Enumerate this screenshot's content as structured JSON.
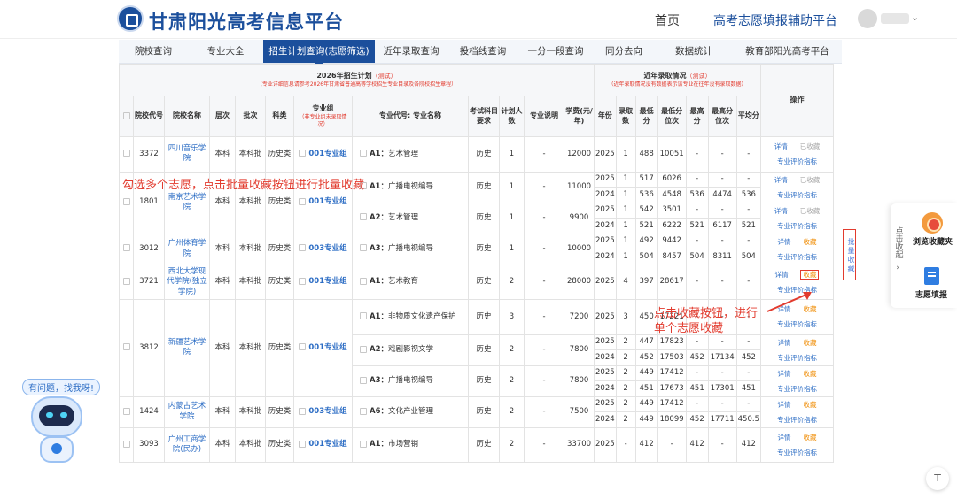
{
  "header": {
    "site_title": "甘肃阳光高考信息平台",
    "home": "首页",
    "assist": "高考志愿填报辅助平台"
  },
  "nav": [
    "院校查询",
    "专业大全",
    "招生计划查询(志愿筛选)",
    "近年录取查询",
    "投档线查询",
    "一分一段查询",
    "同分去向",
    "数据统计",
    "教育部阳光高考平台"
  ],
  "table": {
    "plan_title": "2026年招生计划",
    "plan_tag": "（测试）",
    "plan_note": "（专业详细信息请参考2026年甘肃省普通高等学校招生专业目录及各院校招生章程）",
    "hist_title": "近年录取情况",
    "hist_tag": "（测试）",
    "hist_note": "（近年录取情况没有数据表示该专业在往年没有录取数据）",
    "ops_header": "操作",
    "headers": {
      "code": "院校代号",
      "school": "院校名称",
      "level": "层次",
      "batch": "批次",
      "subject": "科类",
      "group": "专业组",
      "group_note": "（非专业组未录取情况）",
      "major": "专业代号: 专业名称",
      "req": "考试科目要求",
      "plan": "计划人数",
      "desc": "专业说明",
      "fee": "学费(元/年)",
      "year": "年份",
      "admit": "录取数",
      "min": "最低分",
      "minrank": "最低分位次",
      "max": "最高分",
      "maxrank": "最高分位次",
      "avg": "平均分"
    },
    "op_labels": {
      "detail": "详情",
      "collected": "已收藏",
      "collect": "收藏",
      "eval": "专业评价指标"
    },
    "schools": [
      {
        "code": "3372",
        "name": "四川音乐学院",
        "level": "本科",
        "batch": "本科批",
        "subject": "历史类",
        "majors": [
          {
            "group": "001专业组",
            "code": "A1",
            "name": "艺术管理",
            "req": "历史",
            "plan": "1",
            "desc": "-",
            "fee": "12000",
            "hist": [
              [
                "2025",
                "1",
                "488",
                "10051",
                "-",
                "-",
                "-"
              ]
            ],
            "status": "已收藏"
          }
        ]
      },
      {
        "code": "1801",
        "name": "南京艺术学院",
        "level": "本科",
        "batch": "本科批",
        "subject": "历史类",
        "group": "001专业组",
        "majors": [
          {
            "code": "A1",
            "name": "广播电视编导",
            "req": "历史",
            "plan": "1",
            "desc": "-",
            "fee": "11000",
            "hist": [
              [
                "2025",
                "1",
                "517",
                "6026",
                "-",
                "-",
                "-"
              ],
              [
                "2024",
                "1",
                "536",
                "4548",
                "536",
                "4474",
                "536"
              ]
            ],
            "status": "已收藏"
          },
          {
            "code": "A2",
            "name": "艺术管理",
            "req": "历史",
            "plan": "1",
            "desc": "-",
            "fee": "9900",
            "hist": [
              [
                "2025",
                "1",
                "542",
                "3501",
                "-",
                "-",
                "-"
              ],
              [
                "2024",
                "1",
                "521",
                "6222",
                "521",
                "6117",
                "521"
              ]
            ],
            "status": "已收藏"
          }
        ]
      },
      {
        "code": "3012",
        "name": "广州体育学院",
        "level": "本科",
        "batch": "本科批",
        "subject": "历史类",
        "majors": [
          {
            "group": "003专业组",
            "code": "A3",
            "name": "广播电视编导",
            "req": "历史",
            "plan": "1",
            "desc": "-",
            "fee": "10000",
            "hist": [
              [
                "2025",
                "1",
                "492",
                "9442",
                "-",
                "-",
                "-"
              ],
              [
                "2024",
                "1",
                "504",
                "8457",
                "504",
                "8311",
                "504"
              ]
            ],
            "status": "收藏"
          }
        ]
      },
      {
        "code": "3721",
        "name": "西北大学现代学院(独立学院)",
        "level": "本科",
        "batch": "本科批",
        "subject": "历史类",
        "majors": [
          {
            "group": "001专业组",
            "code": "A1",
            "name": "艺术教育",
            "req": "历史",
            "plan": "2",
            "desc": "-",
            "fee": "28000",
            "hist": [
              [
                "2025",
                "4",
                "397",
                "28617",
                "-",
                "-",
                "-"
              ]
            ],
            "status": "收藏"
          }
        ]
      },
      {
        "code": "3812",
        "name": "新疆艺术学院",
        "level": "本科",
        "batch": "本科批",
        "subject": "历史类",
        "group": "001专业组",
        "majors": [
          {
            "code": "A1",
            "name": "非物质文化遗产保护",
            "req": "历史",
            "plan": "3",
            "desc": "-",
            "fee": "7200",
            "hist": [
              [
                "2025",
                "3",
                "450",
                "17221",
                "-",
                "-",
                "-"
              ]
            ],
            "status": "收藏"
          },
          {
            "code": "A2",
            "name": "戏剧影视文学",
            "req": "历史",
            "plan": "2",
            "desc": "-",
            "fee": "7800",
            "hist": [
              [
                "2025",
                "2",
                "447",
                "17823",
                "-",
                "-",
                "-"
              ],
              [
                "2024",
                "2",
                "452",
                "17503",
                "452",
                "17134",
                "452"
              ]
            ],
            "status": "收藏"
          },
          {
            "code": "A3",
            "name": "广播电视编导",
            "req": "历史",
            "plan": "2",
            "desc": "-",
            "fee": "7800",
            "hist": [
              [
                "2025",
                "2",
                "449",
                "17412",
                "-",
                "-",
                "-"
              ],
              [
                "2024",
                "2",
                "451",
                "17673",
                "451",
                "17301",
                "451"
              ]
            ],
            "status": "收藏"
          }
        ]
      },
      {
        "code": "1424",
        "name": "内蒙古艺术学院",
        "level": "本科",
        "batch": "本科批",
        "subject": "历史类",
        "majors": [
          {
            "group": "003专业组",
            "code": "A6",
            "name": "文化产业管理",
            "req": "历史",
            "plan": "2",
            "desc": "-",
            "fee": "7500",
            "hist": [
              [
                "2025",
                "2",
                "449",
                "17412",
                "-",
                "-",
                "-"
              ],
              [
                "2024",
                "2",
                "449",
                "18099",
                "452",
                "17711",
                "450.5"
              ]
            ],
            "status": "收藏"
          }
        ]
      },
      {
        "code": "3093",
        "name": "广州工商学院(民办)",
        "level": "本科",
        "batch": "本科批",
        "subject": "历史类",
        "majors": [
          {
            "group": "001专业组",
            "code": "A1",
            "name": "市场营销",
            "req": "历史",
            "plan": "2",
            "desc": "-",
            "fee": "33700",
            "hist": [
              [
                "2025",
                "-",
                "412",
                "-",
                "412",
                "-",
                "412"
              ]
            ],
            "status": "收藏"
          }
        ]
      }
    ]
  },
  "annotations": {
    "batch_text": "勾选多个志愿，点击批量收藏按钮进行批量收藏",
    "single_text_1": "点击收藏按钮，进行",
    "single_text_2": "单个志愿收藏",
    "batch_button": "批量收藏"
  },
  "side": {
    "toggle": "点击收起",
    "favorites": "浏览收藏夹",
    "fill": "志愿填报"
  },
  "assistant": {
    "bubble": "有问题，找我呀!"
  },
  "colors": {
    "brand": "#1b4f9c",
    "link": "#2b6cc4",
    "alert": "#e23b2e",
    "collect": "#f0900c"
  }
}
